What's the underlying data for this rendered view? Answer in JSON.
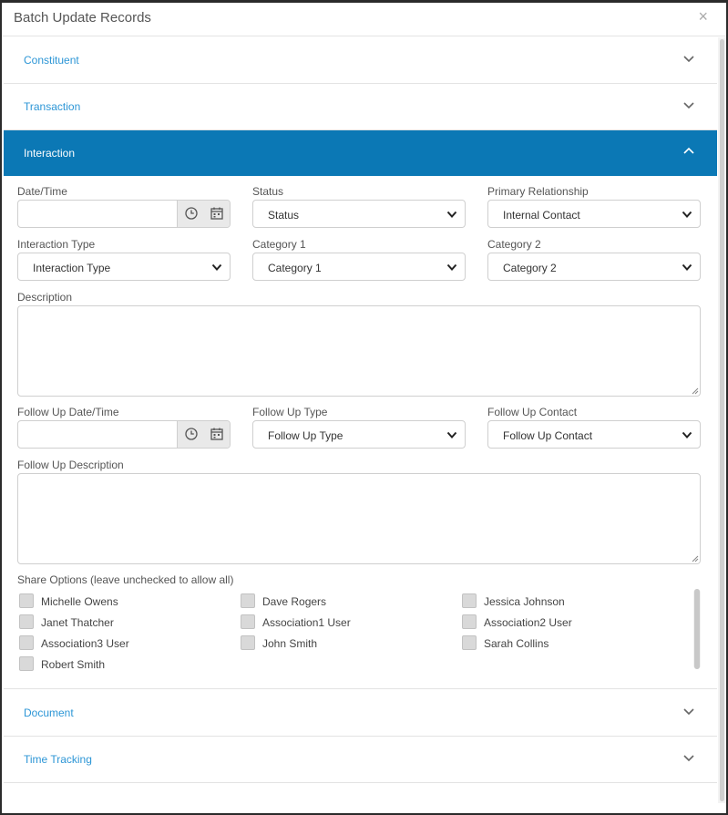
{
  "dialog": {
    "title": "Batch Update Records",
    "close_glyph": "×"
  },
  "sections": {
    "constituent": "Constituent",
    "transaction": "Transaction",
    "interaction": "Interaction",
    "document": "Document",
    "time_tracking": "Time Tracking"
  },
  "interaction": {
    "date_time": {
      "label": "Date/Time",
      "value": ""
    },
    "status": {
      "label": "Status",
      "selected": "Status"
    },
    "primary_relationship": {
      "label": "Primary Relationship",
      "selected": "Internal Contact"
    },
    "interaction_type": {
      "label": "Interaction Type",
      "selected": "Interaction Type"
    },
    "category1": {
      "label": "Category 1",
      "selected": "Category 1"
    },
    "category2": {
      "label": "Category 2",
      "selected": "Category 2"
    },
    "description": {
      "label": "Description",
      "value": ""
    },
    "follow_up_date_time": {
      "label": "Follow Up Date/Time",
      "value": ""
    },
    "follow_up_type": {
      "label": "Follow Up Type",
      "selected": "Follow Up Type"
    },
    "follow_up_contact": {
      "label": "Follow Up Contact",
      "selected": "Follow Up Contact"
    },
    "follow_up_description": {
      "label": "Follow Up Description",
      "value": ""
    },
    "share_options": {
      "label": "Share Options (leave unchecked to allow all)",
      "users": [
        {
          "name": "Michelle Owens",
          "checked": false
        },
        {
          "name": "Dave Rogers",
          "checked": false
        },
        {
          "name": "Jessica Johnson",
          "checked": false
        },
        {
          "name": "Janet Thatcher",
          "checked": false
        },
        {
          "name": "Association1 User",
          "checked": false
        },
        {
          "name": "Association2 User",
          "checked": false
        },
        {
          "name": "Association3 User",
          "checked": false
        },
        {
          "name": "John Smith",
          "checked": false
        },
        {
          "name": "Sarah Collins",
          "checked": false
        },
        {
          "name": "Robert Smith",
          "checked": false
        }
      ]
    }
  },
  "icons": {
    "expand": "chevron-down-icon",
    "collapse": "chevron-up-icon",
    "time": "clock-icon",
    "calendar": "calendar-icon",
    "select": "select-caret-icon"
  },
  "colors": {
    "accent": "#0b78b5",
    "link": "#2d96d6",
    "checkbox": "#d9d9d9"
  }
}
